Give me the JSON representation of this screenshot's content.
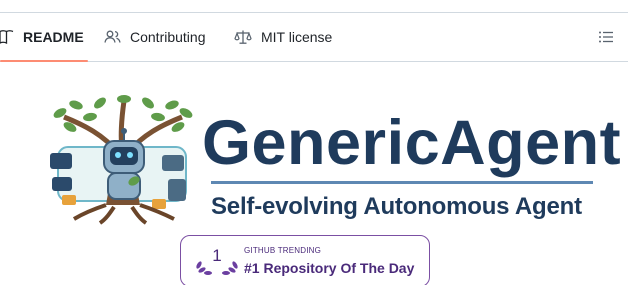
{
  "tabs": [
    {
      "label": "README",
      "icon": "book-icon",
      "active": true
    },
    {
      "label": "Contributing",
      "icon": "people-icon",
      "active": false
    },
    {
      "label": "MIT license",
      "icon": "law-scale-icon",
      "active": false
    }
  ],
  "outline_button": {
    "icon": "list-unordered-icon"
  },
  "banner": {
    "title": "GenericAgent",
    "subtitle": "Self-evolving Autonomous Agent",
    "illustration": "robot-tree-logo"
  },
  "trending_badge": {
    "rank": "1",
    "small_label": "GITHUB TRENDING",
    "label": "#1 Repository Of The Day"
  },
  "colors": {
    "active_tab_underline": "#fd8c73",
    "wordmark": "#1f3b5c",
    "badge": "#4a2a7a"
  }
}
